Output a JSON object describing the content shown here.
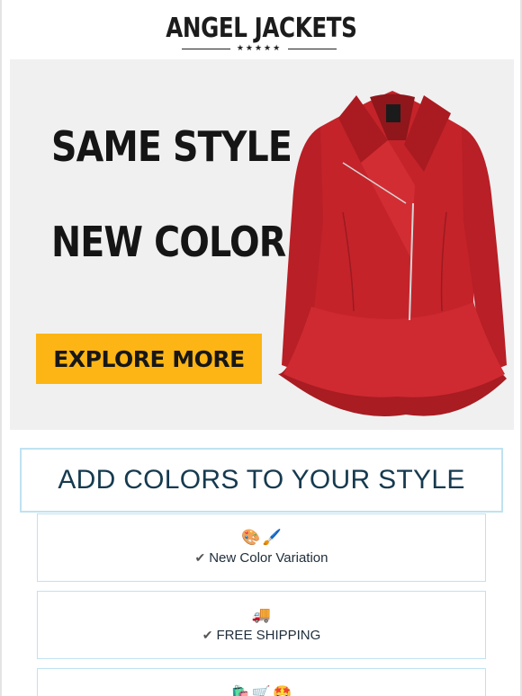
{
  "brand": {
    "name": "ANGEL JACKETS",
    "stars": "★★★★★"
  },
  "banner": {
    "headline_1": "SAME STYLE",
    "headline_2": "NEW COLOR",
    "cta_label": "EXPLORE MORE",
    "cta_color": "#fcb514",
    "jacket_color": "#c4232a"
  },
  "section": {
    "title": "ADD COLORS TO YOUR STYLE"
  },
  "features": [
    {
      "icons": [
        "palette-icon",
        "brush-icon"
      ],
      "check": "✔",
      "label": "New Color Variation"
    },
    {
      "icons": [
        "truck-icon"
      ],
      "check": "✔",
      "label": "FREE SHIPPING"
    },
    {
      "icons": [
        "shopping-bag-icon",
        "cart-icon",
        "star-struck-icon"
      ]
    }
  ]
}
